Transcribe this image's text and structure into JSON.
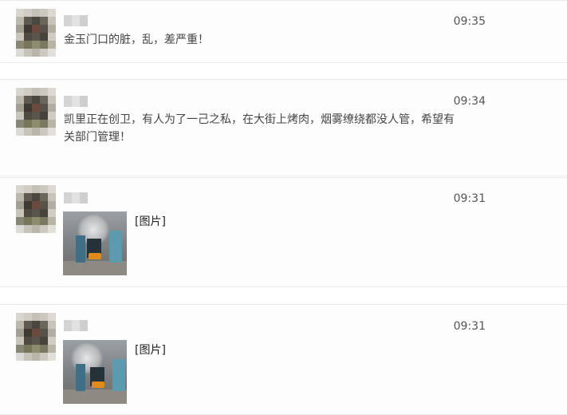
{
  "messages": [
    {
      "time": "09:35",
      "text": "金玉门口的脏，乱，差严重！"
    },
    {
      "time": "09:34",
      "text": "凯里正在创卫，有人为了一己之私，在大街上烤肉，烟雾缭绕都没人管，希望有关部门管理！"
    },
    {
      "time": "09:31",
      "image_label": "[图片]"
    },
    {
      "time": "09:31",
      "image_label": "[图片]"
    }
  ]
}
